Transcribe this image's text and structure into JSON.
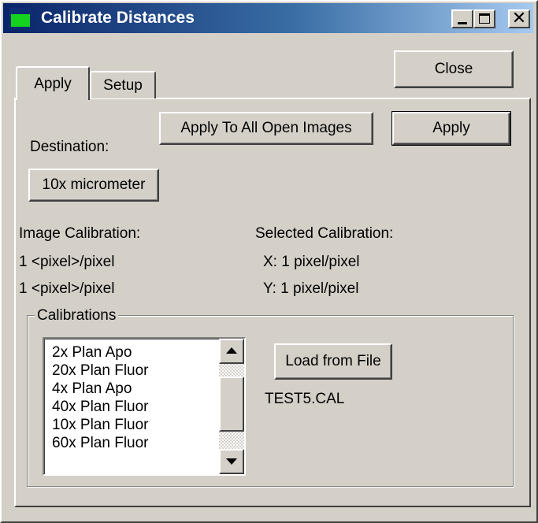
{
  "window": {
    "title": "Calibrate Distances",
    "icon": "app-window-icon",
    "controls": {
      "minimize": "minimize-icon",
      "maximize": "maximize-icon",
      "close": "✕"
    }
  },
  "tabs": [
    {
      "label": "Apply",
      "selected": true
    },
    {
      "label": "Setup",
      "selected": false
    }
  ],
  "buttons": {
    "close": "Close",
    "apply_all": "Apply To All Open Images",
    "apply": "Apply",
    "destination": "10x micrometer",
    "load_file": "Load from File"
  },
  "labels": {
    "destination": "Destination:",
    "image_calibration": "Image Calibration:",
    "selected_calibration": "Selected Calibration:"
  },
  "image_calibration": {
    "x": "1 <pixel>/pixel",
    "y": "1 <pixel>/pixel"
  },
  "selected_calibration": {
    "x": "X:  1 pixel/pixel",
    "y": "Y:  1 pixel/pixel"
  },
  "calibrations": {
    "legend": "Calibrations",
    "items": [
      "2x Plan Apo",
      "20x Plan Fluor",
      "4x Plan Apo",
      "40x Plan Fluor",
      "10x Plan Fluor",
      "60x Plan Fluor"
    ],
    "loaded_file": "TEST5.CAL"
  }
}
